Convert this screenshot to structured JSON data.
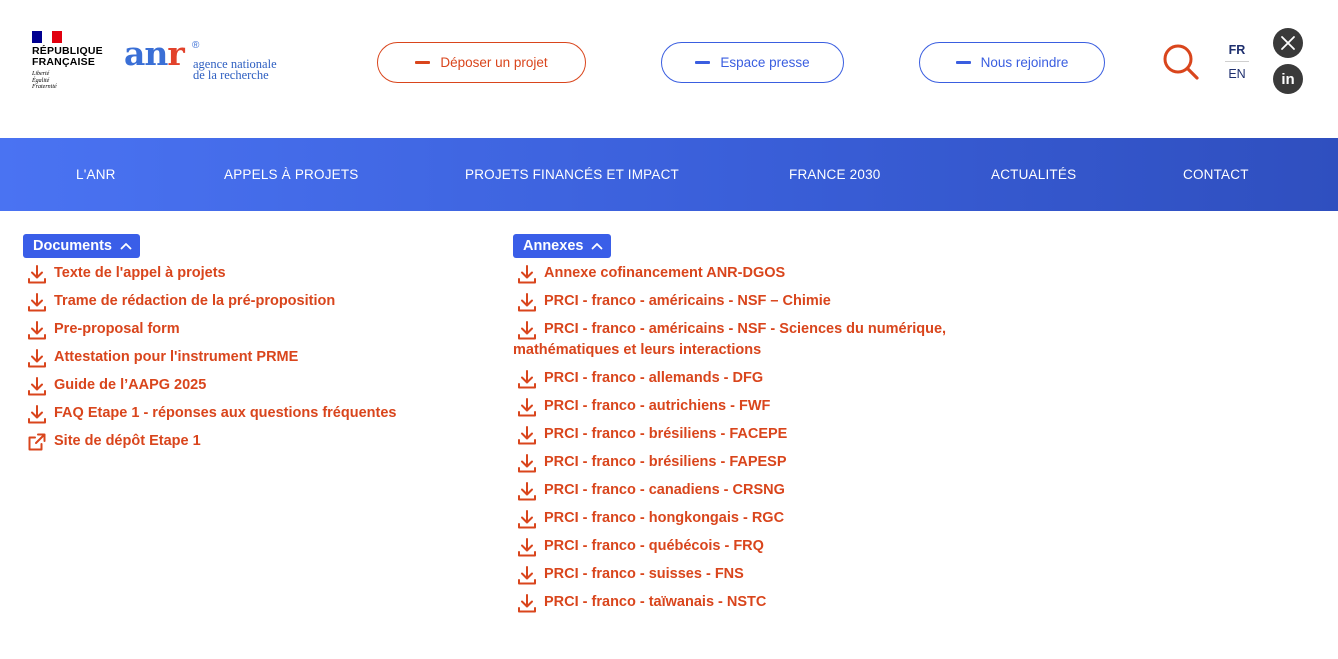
{
  "header": {
    "republique": {
      "line1": "RÉPUBLIQUE",
      "line2": "FRANÇAISE",
      "motto1": "Liberté",
      "motto2": "Égalité",
      "motto3": "Fraternité"
    },
    "anr": {
      "a": "a",
      "n": "n",
      "r": "r",
      "reg": "®",
      "sub1": "agence nationale",
      "sub2": "de la recherche"
    },
    "buttons": {
      "deposer": "Déposer un projet",
      "presse": "Espace presse",
      "rejoindre": "Nous rejoindre"
    },
    "lang": {
      "fr": "FR",
      "en": "EN"
    },
    "social": {
      "x": "𝕏",
      "linkedin": "in"
    }
  },
  "nav": {
    "items": [
      "L'ANR",
      "APPELS À PROJETS",
      "PROJETS FINANCÉS ET IMPACT",
      "FRANCE 2030",
      "ACTUALITÉS",
      "CONTACT"
    ]
  },
  "documents": {
    "title": "Documents",
    "items": [
      {
        "label": "Texte de l'appel à projets",
        "icon": "download-icon"
      },
      {
        "label": "Trame de rédaction de la pré-proposition",
        "icon": "download-icon"
      },
      {
        "label": "Pre-proposal form",
        "icon": "download-icon"
      },
      {
        "label": "Attestation pour l'instrument PRME",
        "icon": "download-icon"
      },
      {
        "label": "Guide de l’AAPG 2025",
        "icon": "download-icon"
      },
      {
        "label": "FAQ Etape 1 - réponses aux questions fréquentes",
        "icon": "download-icon"
      },
      {
        "label": "Site de dépôt Etape 1",
        "icon": "external-link-icon"
      }
    ]
  },
  "annexes": {
    "title": "Annexes",
    "items": [
      "Annexe cofinancement ANR-DGOS",
      "PRCI - franco - américains - NSF – Chimie",
      "PRCI - franco - américains - NSF - Sciences du numérique, mathématiques et leurs interactions",
      "PRCI - franco - allemands - DFG",
      "PRCI - franco - autrichiens - FWF",
      "PRCI - franco - brésiliens - FACEPE",
      "PRCI - franco - brésiliens - FAPESP",
      "PRCI - franco - canadiens - CRSNG",
      "PRCI - franco - hongkongais - RGC",
      "PRCI - franco - québécois - FRQ",
      "PRCI - franco - suisses - FNS",
      "PRCI - franco - taïwanais - NSTC"
    ]
  },
  "colors": {
    "accent_orange": "#d9451c",
    "accent_blue": "#3a5ee8",
    "nav_blue": "#3a5fd9"
  }
}
